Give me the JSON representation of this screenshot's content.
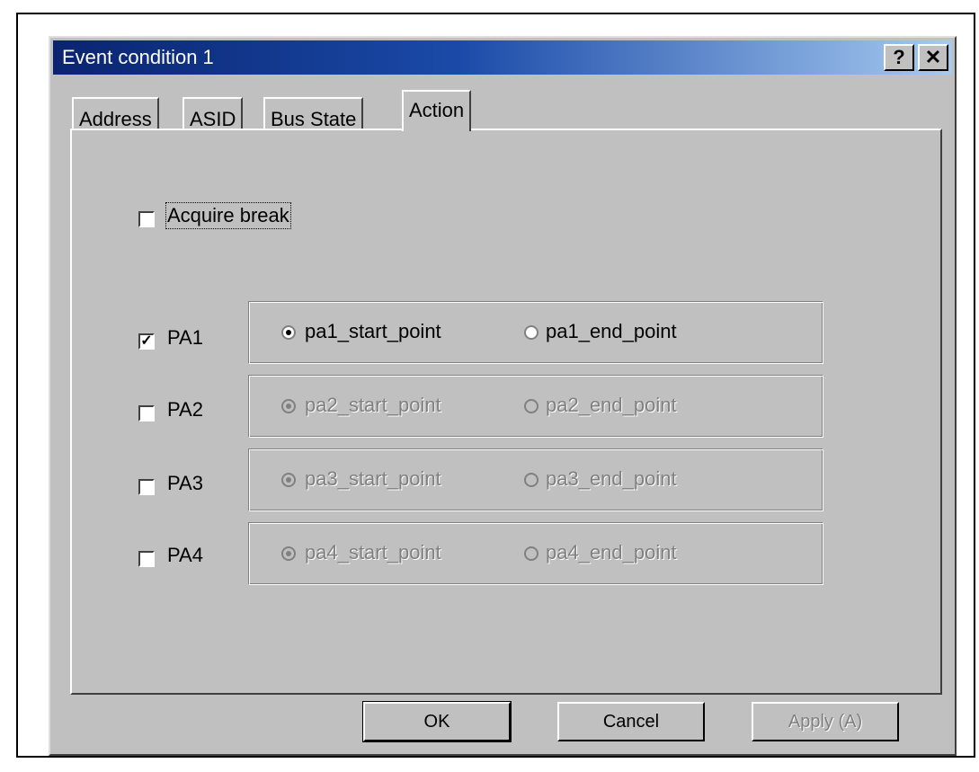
{
  "dialog": {
    "title": "Event condition 1",
    "help_glyph": "?",
    "close_glyph": "✕"
  },
  "tabs": [
    {
      "label": "Address"
    },
    {
      "label": "ASID"
    },
    {
      "label": "Bus State"
    },
    {
      "label": "Action",
      "active": true
    }
  ],
  "action": {
    "acquire_break": {
      "label": "Acquire break",
      "checked": false
    },
    "points": [
      {
        "label": "PA1",
        "checked": true,
        "start": "pa1_start_point",
        "end": "pa1_end_point",
        "selected": "start",
        "enabled": true
      },
      {
        "label": "PA2",
        "checked": false,
        "start": "pa2_start_point",
        "end": "pa2_end_point",
        "selected": "start",
        "enabled": false
      },
      {
        "label": "PA3",
        "checked": false,
        "start": "pa3_start_point",
        "end": "pa3_end_point",
        "selected": "start",
        "enabled": false
      },
      {
        "label": "PA4",
        "checked": false,
        "start": "pa4_start_point",
        "end": "pa4_end_point",
        "selected": "start",
        "enabled": false
      }
    ]
  },
  "buttons": {
    "ok": "OK",
    "cancel": "Cancel",
    "apply": "Apply (A)"
  },
  "colors": {
    "face": "#c0c0c0",
    "title_start": "#0a2470",
    "title_end": "#a6caf0",
    "disabled_text": "#808080"
  }
}
